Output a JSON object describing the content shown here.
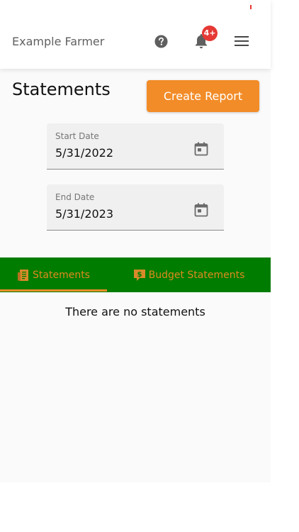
{
  "header": {
    "user_name": "Example Farmer",
    "notification_badge": "4+",
    "icons": [
      "help-icon",
      "bell-icon",
      "hamburger-menu-icon"
    ]
  },
  "page": {
    "title": "Statements",
    "create_report_label": "Create Report"
  },
  "filters": {
    "start_date": {
      "label": "Start Date",
      "value": "5/31/2022",
      "icon": "calendar-icon"
    },
    "end_date": {
      "label": "End Date",
      "value": "5/31/2023",
      "icon": "calendar-icon"
    }
  },
  "tabs": [
    {
      "label": "Statements",
      "icon": "invoice-icon",
      "active": true
    },
    {
      "label": "Budget Statements",
      "icon": "dollar-note-icon",
      "active": false
    }
  ],
  "content": {
    "empty_message": "There are no statements"
  },
  "colors": {
    "accent_orange": "#f28c28",
    "tab_bar_green": "#007c00",
    "tab_text": "#e08a1e",
    "badge_red": "#e53935"
  }
}
